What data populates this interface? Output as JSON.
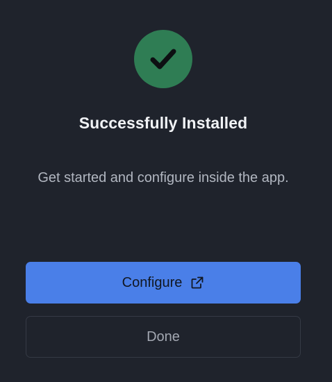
{
  "dialog": {
    "title": "Successfully Installed",
    "description": "Get started and configure inside the app.",
    "primary_button": {
      "label": "Configure",
      "icon": "external-link-icon"
    },
    "secondary_button": {
      "label": "Done"
    },
    "status_icon": "checkmark-icon"
  },
  "colors": {
    "background": "#1f232c",
    "success": "#2f7d54",
    "primary": "#4a7fe8",
    "secondary_border": "#353a45"
  }
}
